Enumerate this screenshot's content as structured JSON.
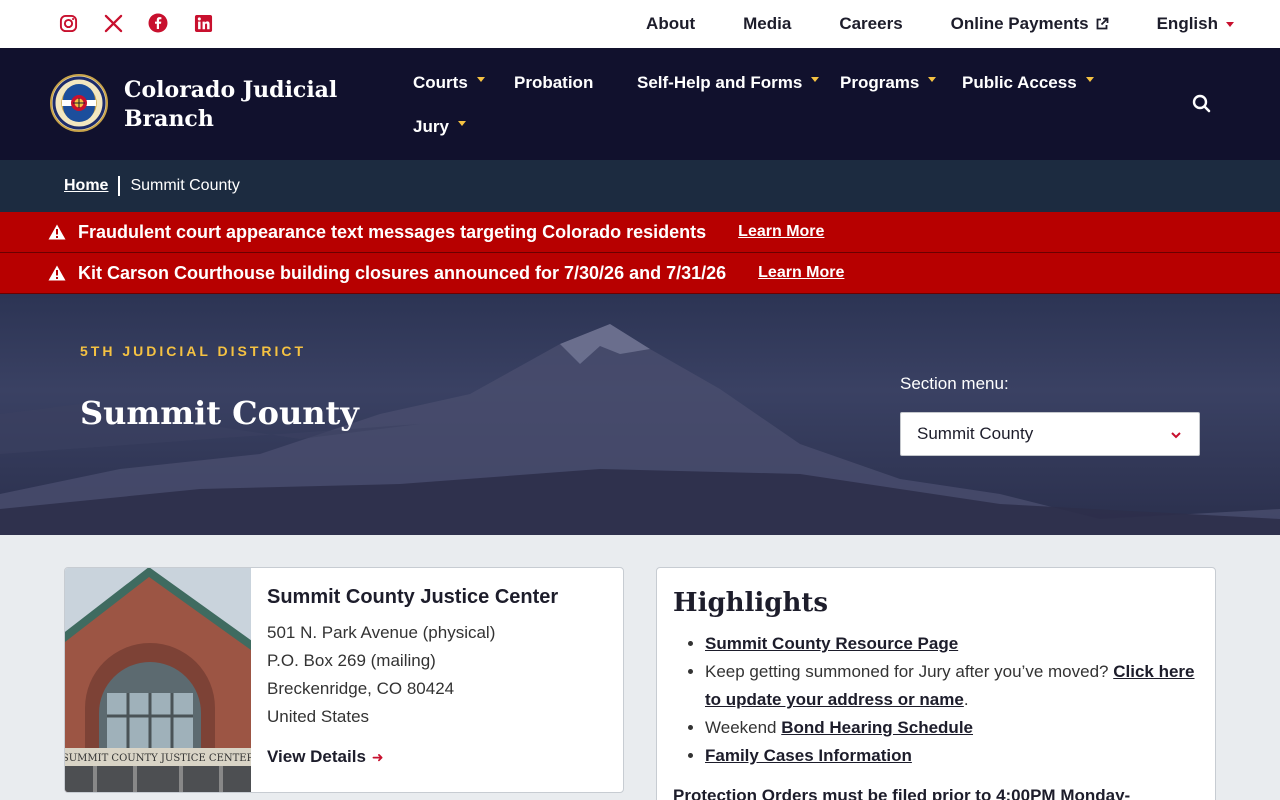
{
  "social": [
    {
      "name": "instagram-icon"
    },
    {
      "name": "x-twitter-icon"
    },
    {
      "name": "facebook-icon"
    },
    {
      "name": "linkedin-icon"
    }
  ],
  "utility": {
    "about": "About",
    "media": "Media",
    "careers": "Careers",
    "payments": "Online Payments",
    "language": "English"
  },
  "brand": {
    "name": "Colorado Judicial Branch"
  },
  "nav": {
    "courts": "Courts",
    "probation": "Probation",
    "self_help": "Self-Help and Forms",
    "programs": "Programs",
    "public_access": "Public Access",
    "jury": "Jury"
  },
  "breadcrumb": {
    "home": "Home",
    "current": "Summit County"
  },
  "alerts": [
    {
      "message": "Fraudulent court appearance text messages targeting Colorado residents",
      "link": "Learn More"
    },
    {
      "message": "Kit Carson Courthouse building closures announced for 7/30/26 and 7/31/26",
      "link": "Learn More"
    }
  ],
  "hero": {
    "district": "5TH JUDICIAL DISTRICT",
    "title": "Summit County",
    "section_label": "Section menu:",
    "section_value": "Summit County"
  },
  "justice_center": {
    "title": "Summit County Justice Center",
    "address_1": "501 N. Park Avenue (physical)",
    "address_2": "P.O. Box 269 (mailing)",
    "address_3": "Breckenridge, CO 80424",
    "address_4": "United States",
    "link": "View Details",
    "photo_sign": "SUMMIT COUNTY JUSTICE CENTER"
  },
  "highlights": {
    "title": "Highlights",
    "item1_link": "Summit County Resource Page",
    "item2_text": "Keep getting summoned for Jury after you’ve moved?",
    "item2_link": "Click here to update your address or name",
    "item2_end": ".",
    "item3_text": "Weekend",
    "item3_link": "Bond Hearing Schedule",
    "item4_link": "Family Cases Information",
    "note_link": "Protection Orders",
    "note_text": "must be filed prior to 4:00PM Monday-"
  },
  "colors": {
    "header_bg": "#11112d",
    "alert_bg": "#b70000",
    "accent_gold": "#f5c242",
    "accent_red": "#c8102e"
  }
}
